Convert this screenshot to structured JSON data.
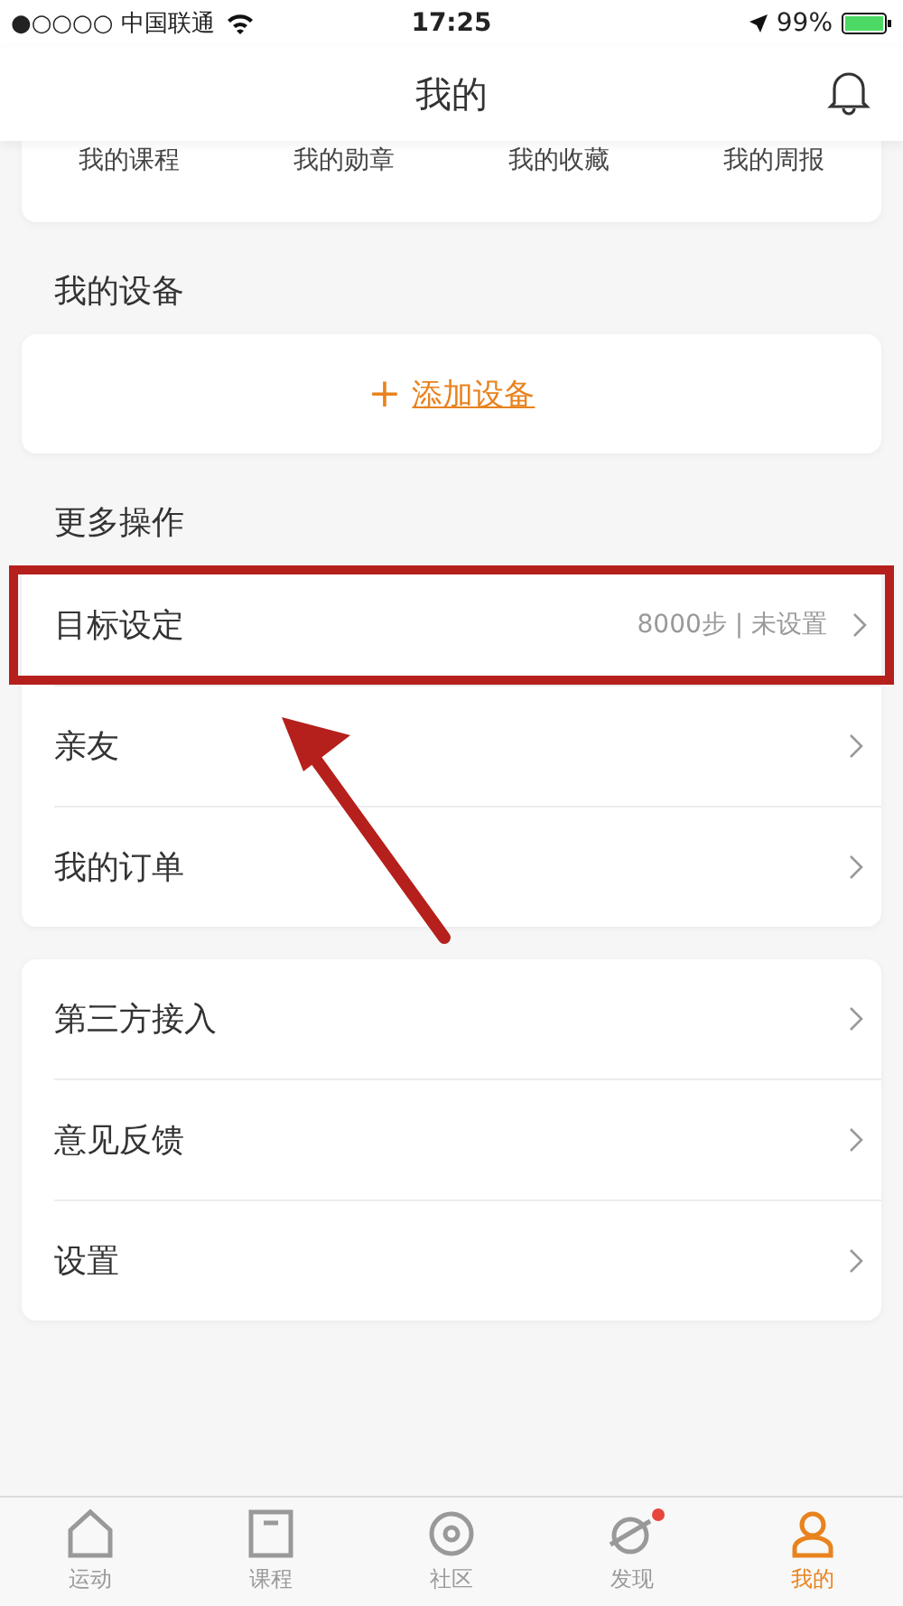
{
  "status_bar": {
    "carrier": "●○○○○ 中国联通",
    "time": "17:25",
    "battery": "99%"
  },
  "header": {
    "title": "我的"
  },
  "shortcuts": [
    {
      "label": "我的课程"
    },
    {
      "label": "我的勋章"
    },
    {
      "label": "我的收藏"
    },
    {
      "label": "我的周报"
    }
  ],
  "devices": {
    "heading": "我的设备",
    "add_icon": "+",
    "add_label": "添加设备"
  },
  "more": {
    "heading": "更多操作",
    "items": [
      {
        "label": "目标设定",
        "value": "8000步 | 未设置",
        "highlighted": true
      },
      {
        "label": "亲友",
        "highlighted": false
      },
      {
        "label": "我的订单",
        "highlighted": false
      }
    ]
  },
  "others": [
    {
      "label": "第三方接入"
    },
    {
      "label": "意见反馈"
    },
    {
      "label": "设置"
    }
  ],
  "tab_bar": [
    {
      "label": "运动",
      "kind": "home",
      "selected": false,
      "badge": false
    },
    {
      "label": "课程",
      "kind": "book",
      "selected": false,
      "badge": false
    },
    {
      "label": "社区",
      "kind": "disc",
      "selected": false,
      "badge": false
    },
    {
      "label": "发现",
      "kind": "planet",
      "selected": false,
      "badge": true
    },
    {
      "label": "我的",
      "kind": "person",
      "selected": true,
      "badge": false
    }
  ]
}
